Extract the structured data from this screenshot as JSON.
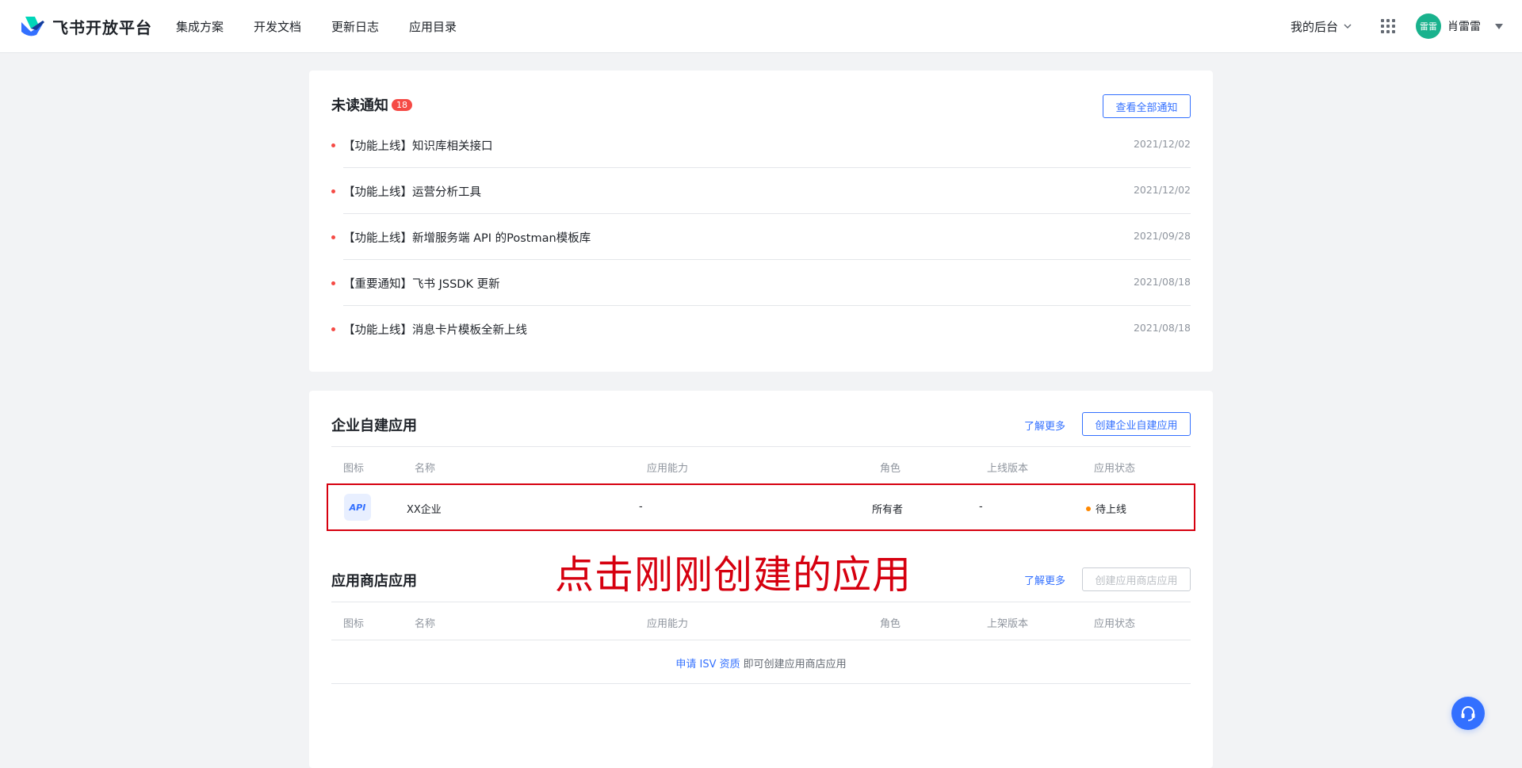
{
  "header": {
    "logo_text": "飞书开放平台",
    "nav": [
      "集成方案",
      "开发文档",
      "更新日志",
      "应用目录"
    ],
    "backend_label": "我的后台",
    "avatar_text": "雷雷",
    "user_name": "肖雷雷"
  },
  "notices": {
    "title": "未读通知",
    "badge": "18",
    "view_all": "查看全部通知",
    "items": [
      {
        "text": "【功能上线】知识库相关接口",
        "date": "2021/12/02"
      },
      {
        "text": "【功能上线】运营分析工具",
        "date": "2021/12/02"
      },
      {
        "text": "【功能上线】新增服务端 API 的Postman模板库",
        "date": "2021/09/28"
      },
      {
        "text": "【重要通知】飞书 JSSDK 更新",
        "date": "2021/08/18"
      },
      {
        "text": "【功能上线】消息卡片模板全新上线",
        "date": "2021/08/18"
      }
    ]
  },
  "custom_apps": {
    "title": "企业自建应用",
    "learn_more": "了解更多",
    "create_button": "创建企业自建应用",
    "columns": [
      "图标",
      "名称",
      "应用能力",
      "角色",
      "上线版本",
      "应用状态"
    ],
    "row": {
      "icon": "API",
      "name": "XX企业",
      "capability": "-",
      "role": "所有者",
      "version": "-",
      "status": "待上线"
    }
  },
  "store_apps": {
    "title": "应用商店应用",
    "learn_more": "了解更多",
    "create_button": "创建应用商店应用",
    "columns": [
      "图标",
      "名称",
      "应用能力",
      "角色",
      "上架版本",
      "应用状态"
    ],
    "empty_link": "申请 ISV 资质",
    "empty_text": "即可创建应用商店应用"
  },
  "annotation": "点击刚刚创建的应用",
  "colors": {
    "accent": "#3370ff",
    "annotation": "#d6000f",
    "badge": "#f54a45",
    "pending": "#ff8800"
  },
  "icons": [
    "feishu-logo-icon",
    "chevron-down-icon",
    "app-grid-icon",
    "caret-down-icon",
    "headset-icon"
  ]
}
